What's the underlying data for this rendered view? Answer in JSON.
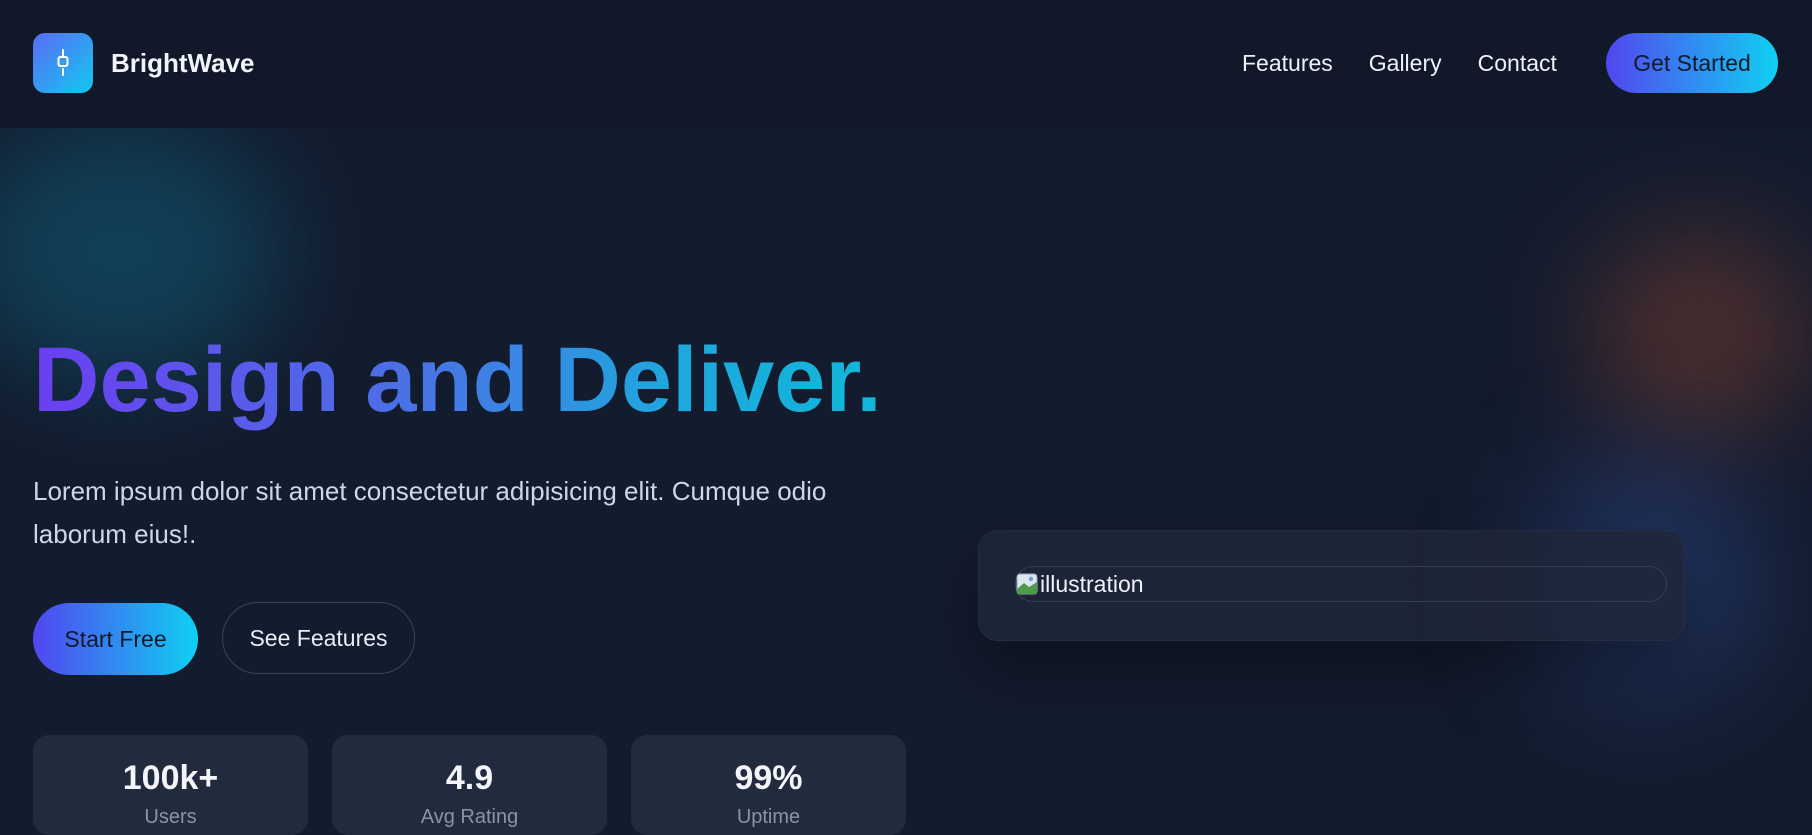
{
  "brand": {
    "name": "BrightWave",
    "logo_icon": "plug-icon"
  },
  "nav": {
    "items": [
      "Features",
      "Gallery",
      "Contact"
    ],
    "cta": "Get Started"
  },
  "hero": {
    "title": "Design and Deliver.",
    "description": "Lorem ipsum dolor sit amet consectetur adipisicing elit. Cumque odio laborum eius!.",
    "primary_button": "Start Free",
    "secondary_button": "See Features"
  },
  "stats": [
    {
      "value": "100k+",
      "label": "Users"
    },
    {
      "value": "4.9",
      "label": "Avg Rating"
    },
    {
      "value": "99%",
      "label": "Uptime"
    }
  ],
  "illustration": {
    "alt_text": "illustration",
    "icon": "broken-image-icon"
  },
  "colors": {
    "background": "#131b2e",
    "header": "#111829",
    "accent_start": "#5246f0",
    "accent_end": "#10d0f2"
  }
}
